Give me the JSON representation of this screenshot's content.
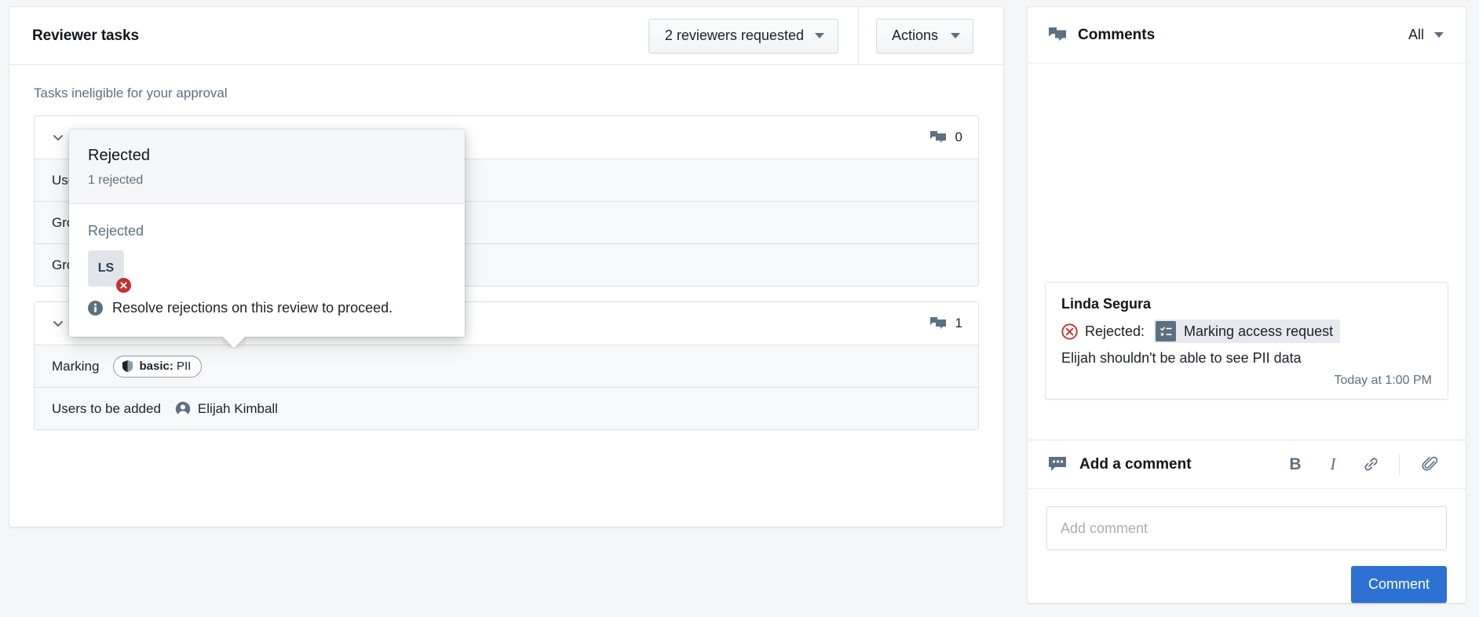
{
  "left": {
    "title": "Reviewer tasks",
    "reviewers_button": "2 reviewers requested",
    "actions_button": "Actions",
    "section_label": "Tasks ineligible for your approval",
    "tasks": [
      {
        "name": "",
        "rejected": false,
        "comment_count": "0",
        "rows": [
          {
            "key": "User",
            "value": ""
          },
          {
            "key": "Grou",
            "value": ""
          },
          {
            "key": "Grou",
            "value": ""
          }
        ]
      },
      {
        "name": "Marking access request",
        "rejected": true,
        "comment_count": "1",
        "rows": [
          {
            "key": "Marking",
            "tag_prefix": "basic:",
            "tag_suffix": "PII"
          },
          {
            "key": "Users to be added",
            "user": "Elijah Kimball"
          }
        ]
      }
    ]
  },
  "popover": {
    "title": "Rejected",
    "subtitle": "1 rejected",
    "group_label": "Rejected",
    "avatar_initials": "LS",
    "note": "Resolve rejections on this review to proceed."
  },
  "right": {
    "header_title": "Comments",
    "filter_value": "All",
    "comment": {
      "author": "Linda Segura",
      "status_label": "Rejected:",
      "reference": "Marking access request",
      "body": "Elijah shouldn't be able to see PII data",
      "timestamp": "Today at 1:00 PM"
    },
    "add_comment": {
      "title": "Add a comment",
      "bold_label": "B",
      "italic_label": "I",
      "placeholder": "Add comment",
      "submit_label": "Comment"
    }
  },
  "colors": {
    "accent": "#2d72d2",
    "danger": "#c23030",
    "muted": "#5c7080",
    "page_bg": "#f5f6f7"
  }
}
